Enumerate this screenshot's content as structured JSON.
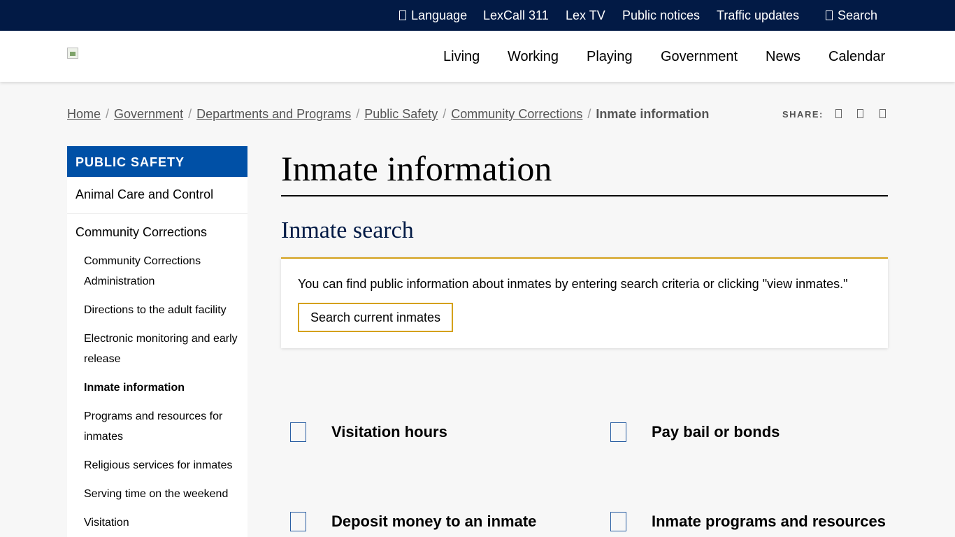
{
  "utility_nav": {
    "language": "Language",
    "lexcall": "LexCall 311",
    "lextv": "Lex TV",
    "public_notices": "Public notices",
    "traffic": "Traffic updates",
    "search": "Search"
  },
  "main_nav": [
    "Living",
    "Working",
    "Playing",
    "Government",
    "News",
    "Calendar"
  ],
  "breadcrumb": {
    "links": [
      "Home",
      "Government",
      "Departments and Programs",
      "Public Safety",
      "Community Corrections"
    ],
    "separator": "/",
    "current": "Inmate information"
  },
  "share": {
    "label": "SHARE:",
    "icons": [
      "facebook-icon",
      "twitter-icon",
      "email-icon"
    ]
  },
  "sidebar": {
    "heading": "PUBLIC SAFETY",
    "items": [
      "Animal Care and Control",
      "Community Corrections"
    ],
    "subitems": [
      "Community Corrections Administration",
      "Directions to the adult facility",
      "Electronic monitoring and early release",
      "Inmate information",
      "Programs and resources for inmates",
      "Religious services for inmates",
      "Serving time on the weekend",
      "Visitation"
    ],
    "active_subitem": "Inmate information"
  },
  "page": {
    "title": "Inmate information",
    "section_title": "Inmate search",
    "card_text": "You can find public information about inmates by entering search criteria or clicking \"view inmates.\"",
    "card_button": "Search current inmates"
  },
  "quick_links": [
    "Visitation hours",
    "Pay bail or bonds",
    "Deposit money to an inmate",
    "Inmate programs and resources"
  ],
  "colors": {
    "utility_bar": "#021a45",
    "sidebar_heading": "#0050a6",
    "accent_gold": "#d4a11b",
    "icon_blue": "#2b5fa3"
  }
}
